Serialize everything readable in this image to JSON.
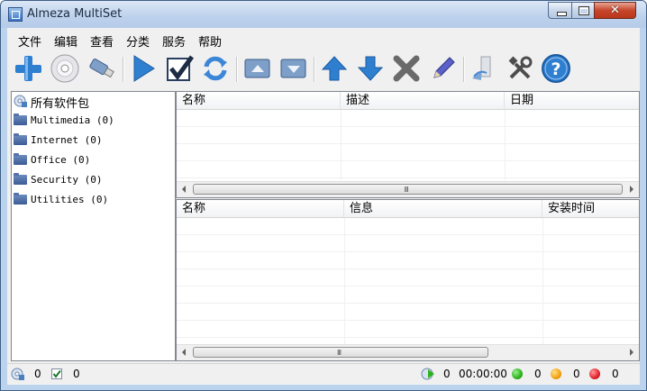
{
  "window": {
    "title": "Almeza MultiSet"
  },
  "menu": [
    "文件",
    "编辑",
    "查看",
    "分类",
    "服务",
    "帮助"
  ],
  "toolbar": {
    "buttons": [
      "add-icon",
      "cd-disc-icon",
      "usb-drive-icon",
      "play-icon",
      "checkmark-icon",
      "refresh-icon",
      "folder-up-icon",
      "folder-down-icon",
      "arrow-up-icon",
      "arrow-down-icon",
      "delete-icon",
      "edit-pencil-icon",
      "computer-icon",
      "tools-icon",
      "help-icon"
    ]
  },
  "tree": {
    "root": "所有软件包",
    "items": [
      "Multimedia (0)",
      "Internet (0)",
      "Office (0)",
      "Security (0)",
      "Utilities (0)"
    ]
  },
  "packages_list": {
    "columns": [
      "名称",
      "描述",
      "日期"
    ],
    "rows": []
  },
  "installed_list": {
    "columns": [
      "名称",
      "信息",
      "安装时间"
    ],
    "rows": []
  },
  "scrollbar_grip": "III",
  "statusbar": {
    "packages_count": "0",
    "checked_count": "0",
    "queue_count": "0",
    "elapsed_time": "00:00:00",
    "green_count": "0",
    "orange_count": "0",
    "red_count": "0"
  },
  "colors": {
    "green": "#2bb21b",
    "orange": "#f5a00f",
    "red": "#e0202a",
    "accent": "#2f7fd0"
  }
}
